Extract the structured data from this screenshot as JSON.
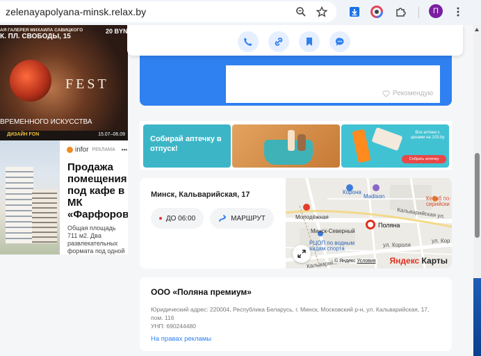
{
  "browser": {
    "url": "zelenayapolyana-minsk.relax.by",
    "profile_initial": "П"
  },
  "ads": {
    "fest": {
      "line1": "АЯ ГАЛЕРЕЯ МИХАИЛА САВИЦКОГО",
      "line2": "К. ПЛ. СВОБОДЫ, 15",
      "dates_top": "20 BYN",
      "title": "FEST",
      "subtitle": "ВРЕМЕННОГО ИСКУССТВА",
      "brand": "ДИЗАЙН FON",
      "dates": "15.07–06.09"
    },
    "realty": {
      "source": "infor",
      "tag": "РЕКЛАМА",
      "more": "•••",
      "title": "Продажа помещения под кафе в МК «Фарфоровы",
      "desc": "Общая площадь 711 м2. Два развлекательных формата под одной"
    }
  },
  "card": {
    "recommend_label": "Рекомендую"
  },
  "promo": {
    "left_text": "Собирай аптечку в отпуск!",
    "right_text": "Все аптеки с ценами на 103.by",
    "right_button": "Собрать аптечку"
  },
  "address": {
    "street": "Минск, Кальварийская, 17",
    "hours": "ДО 06:00",
    "route": "МАРШРУТ"
  },
  "map": {
    "labels": [
      "Корона",
      "Madison",
      "Кебаб по-сирийски",
      "Молодёжная",
      "Минск-Северный",
      "Поляна",
      "Кальварийская ул.",
      "РЦОП по водным видам спорта",
      "ул. Короля",
      "ул. Кор",
      "Кальварийская ул"
    ],
    "copyright": "© Яндекс",
    "terms": "Условия",
    "logo_y": "Яндекс",
    "logo_rest": " Карты"
  },
  "company": {
    "name": "ООО «Поляна премиум»",
    "legal_address": "Юридический адрес: 220004, Республика Беларусь, г. Минск, Московский р-н, ул. Кальварийская, 17, пом. 116",
    "unp": "УНП: 690244480",
    "ad_link": "На правах рекламы"
  },
  "colors": {
    "primary": "#2f80f0",
    "accent_red": "#e03535"
  }
}
